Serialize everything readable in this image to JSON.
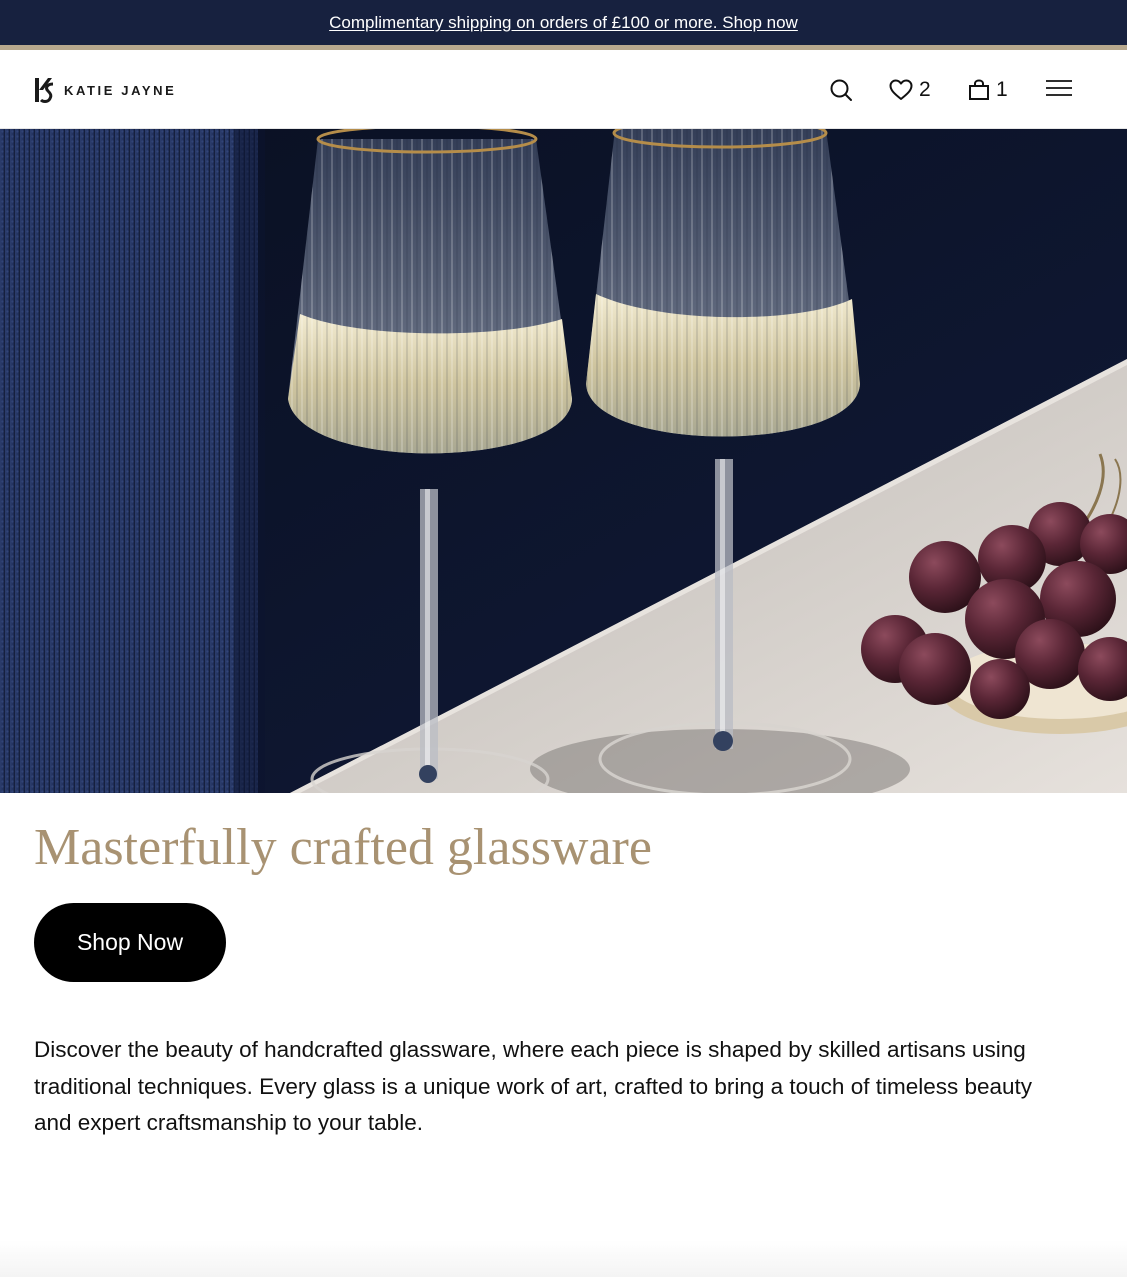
{
  "announcement": {
    "text": "Complimentary shipping on orders of £100 or more. Shop now"
  },
  "header": {
    "logo_text": "KATIE JAYNE",
    "wishlist_count": "2",
    "cart_count": "1",
    "icons": [
      "search-icon",
      "heart-icon",
      "bag-icon",
      "menu-icon"
    ]
  },
  "hero": {
    "image_alt": "Two ribbed wine glasses with gold rims filled with white wine beside a plate of red grapes"
  },
  "content": {
    "headline": "Masterfully crafted glassware",
    "cta_label": "Shop Now",
    "description": "Discover the beauty of handcrafted glassware, where each piece is shaped by skilled artisans using traditional techniques. Every glass is a unique work of art, crafted to bring a touch of timeless beauty and expert craftsmanship to your table."
  },
  "colors": {
    "announcement_bg": "#17213f",
    "accent_rule": "#b7a88e",
    "headline": "#a89272",
    "button_bg": "#000000"
  }
}
